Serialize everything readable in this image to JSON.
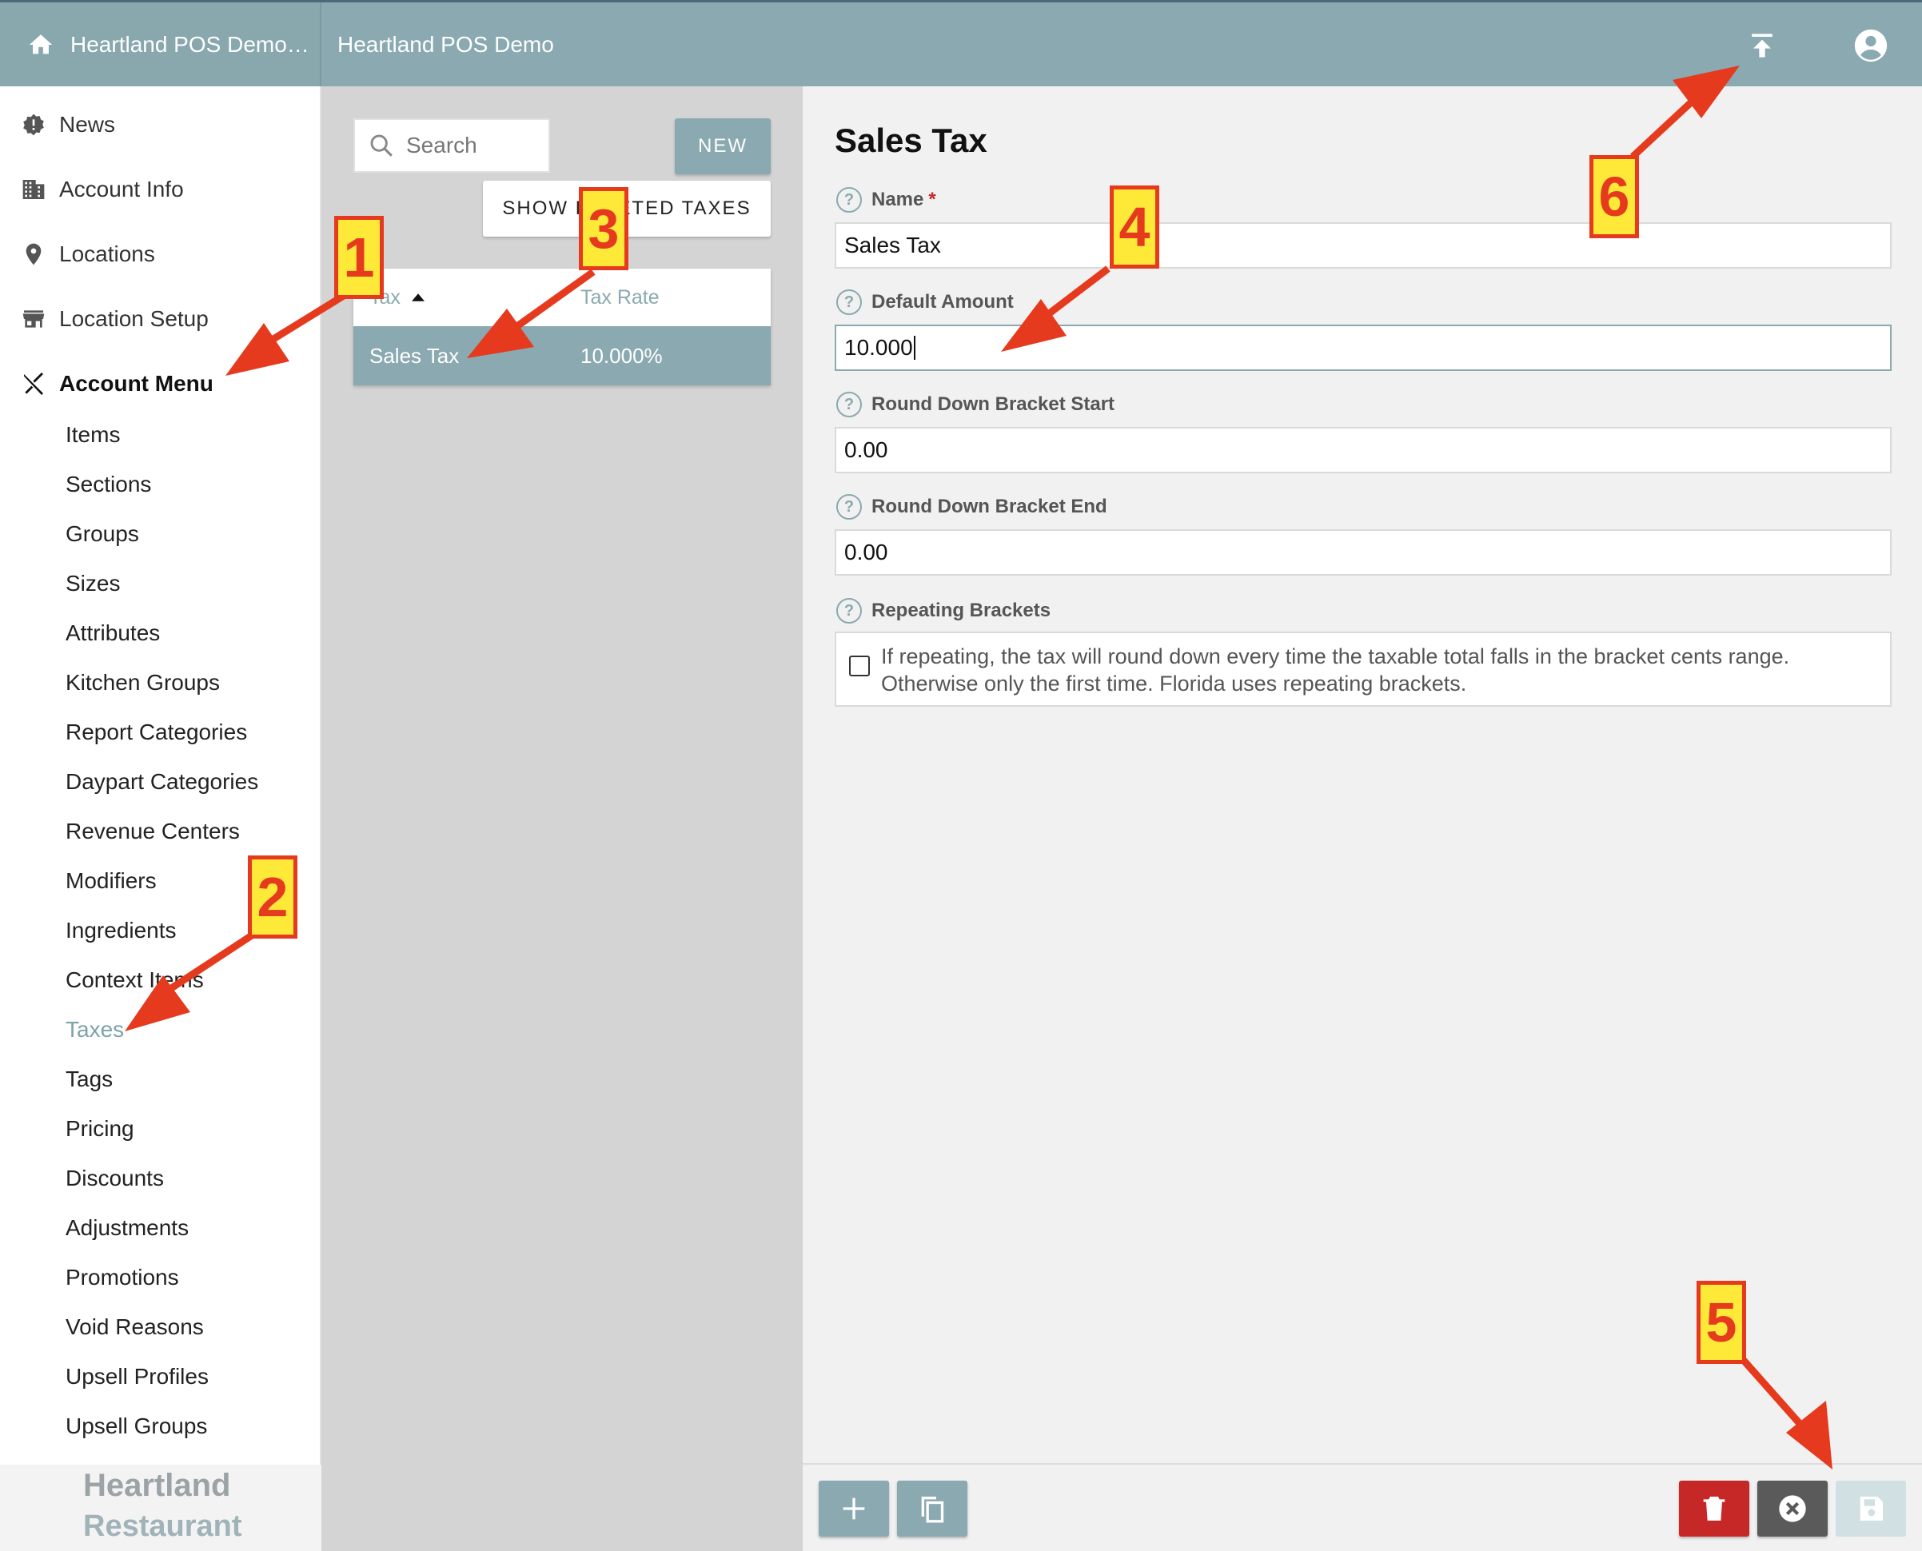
{
  "topbar": {
    "org_label": "Heartland POS Demo…",
    "title": "Heartland POS Demo"
  },
  "sidebar": {
    "top_items": [
      {
        "label": "News",
        "icon": "news-icon"
      },
      {
        "label": "Account Info",
        "icon": "building-icon"
      },
      {
        "label": "Locations",
        "icon": "location-pin-icon"
      },
      {
        "label": "Location Setup",
        "icon": "store-icon"
      }
    ],
    "section": {
      "label": "Account Menu",
      "icon": "utensils-icon"
    },
    "sub_items": [
      "Items",
      "Sections",
      "Groups",
      "Sizes",
      "Attributes",
      "Kitchen Groups",
      "Report Categories",
      "Daypart Categories",
      "Revenue Centers",
      "Modifiers",
      "Ingredients",
      "Context Items",
      "Taxes",
      "Tags",
      "Pricing",
      "Discounts",
      "Adjustments",
      "Promotions",
      "Void Reasons",
      "Upsell Profiles",
      "Upsell Groups"
    ],
    "active_item": "Taxes",
    "brand_line1": "Heartland",
    "brand_line2": "Restaurant"
  },
  "list": {
    "search_placeholder": "Search",
    "new_label": "NEW",
    "show_deleted_label": "SHOW DELETED TAXES",
    "columns": [
      "Tax",
      "Tax Rate"
    ],
    "rows": [
      {
        "tax": "Sales Tax",
        "rate": "10.000%"
      }
    ]
  },
  "detail": {
    "title": "Sales Tax",
    "name_label": "Name",
    "name_required": "*",
    "name_value": "Sales Tax",
    "default_amount_label": "Default Amount",
    "default_amount_value": "10.000",
    "round_start_label": "Round Down Bracket Start",
    "round_start_value": "0.00",
    "round_end_label": "Round Down Bracket End",
    "round_end_value": "0.00",
    "repeating_label": "Repeating Brackets",
    "repeating_text": "If repeating, the tax will round down every time the taxable total falls in the bracket cents range. Otherwise only the first time. Florida uses repeating brackets.",
    "repeating_checked": false
  },
  "footer": {
    "buttons": [
      "add-icon",
      "copy-icon",
      "trash-icon",
      "cancel-icon",
      "save-icon"
    ]
  },
  "callouts": [
    "1",
    "2",
    "3",
    "4",
    "5",
    "6"
  ],
  "colors": {
    "accent": "#8aa9b0",
    "delete": "#c62828",
    "cancel": "#5a5a5a",
    "callout_bg": "#ffe938",
    "callout_border": "#e53a1e"
  }
}
